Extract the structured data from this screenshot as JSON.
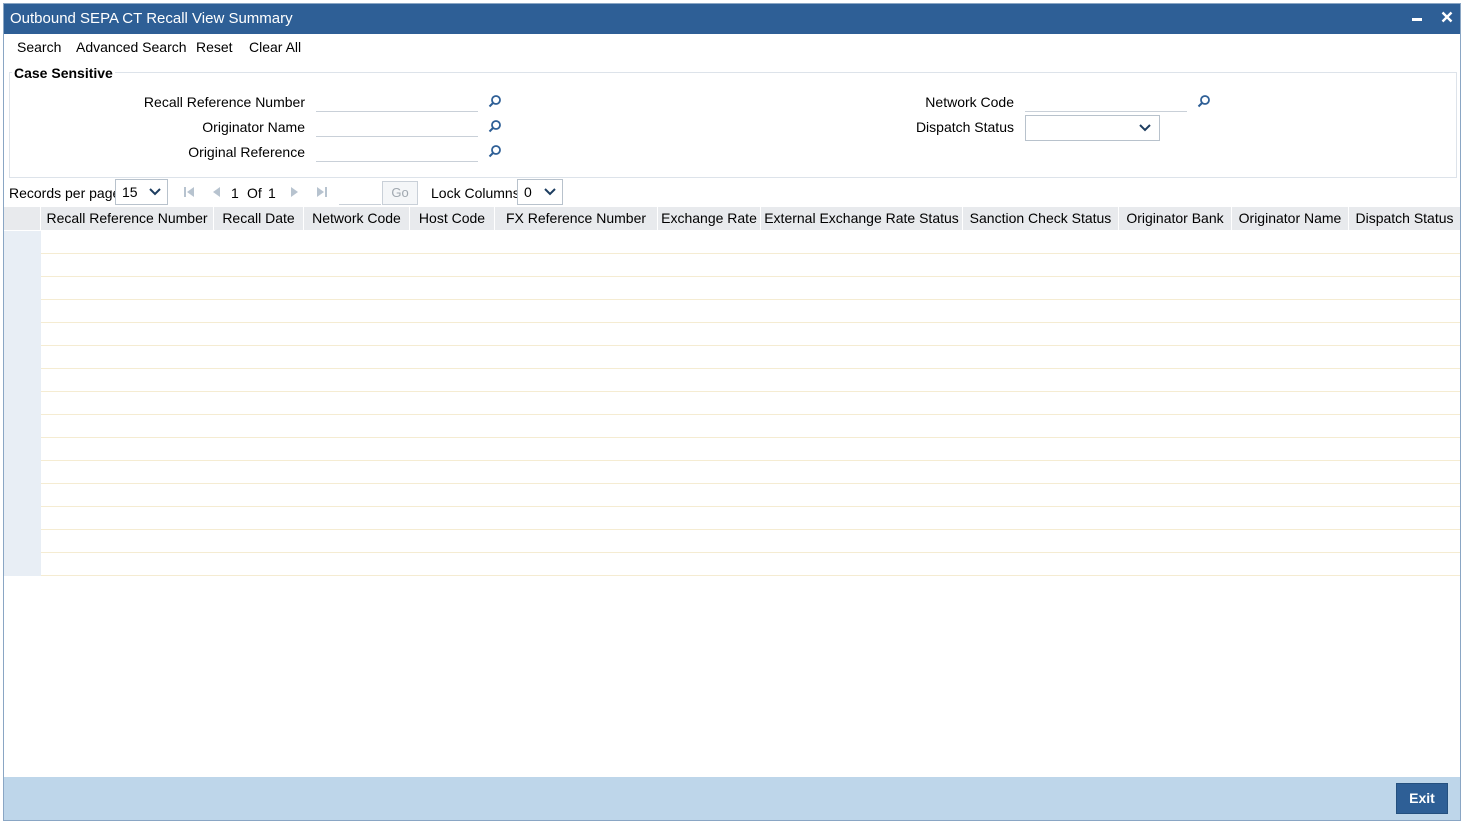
{
  "window": {
    "title": "Outbound SEPA CT Recall View Summary",
    "minimize_icon": "minimize-icon",
    "close_icon": "close-icon"
  },
  "menu": {
    "search": "Search",
    "advanced_search": "Advanced Search",
    "reset": "Reset",
    "clear_all": "Clear All"
  },
  "criteria": {
    "legend": "Case Sensitive",
    "recall_reference_number": {
      "label": "Recall Reference Number",
      "value": ""
    },
    "originator_name": {
      "label": "Originator Name",
      "value": ""
    },
    "original_reference": {
      "label": "Original Reference",
      "value": ""
    },
    "network_code": {
      "label": "Network Code",
      "value": ""
    },
    "dispatch_status": {
      "label": "Dispatch Status",
      "value": ""
    }
  },
  "pager": {
    "records_per_page_label": "Records per page",
    "records_per_page": "15",
    "current_page": "1",
    "of_label": "Of",
    "total_pages": "1",
    "goto_value": "",
    "go_label": "Go",
    "lock_columns_label": "Lock Columns",
    "lock_columns": "0"
  },
  "grid": {
    "columns": [
      "Recall Reference Number",
      "Recall Date",
      "Network Code",
      "Host Code",
      "FX Reference Number",
      "Exchange Rate",
      "External Exchange Rate Status",
      "Sanction Check Status",
      "Originator Bank",
      "Originator Name",
      "Dispatch Status"
    ],
    "rows": 15
  },
  "footer": {
    "exit": "Exit"
  },
  "colors": {
    "titlebar": "#2e5f96",
    "footer": "#bed6ea",
    "header": "#e8eaed"
  }
}
